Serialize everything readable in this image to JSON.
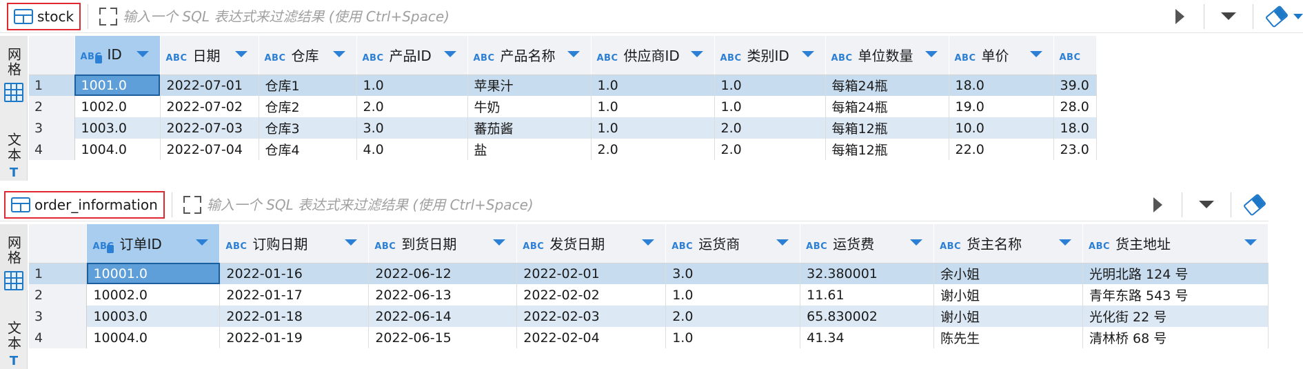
{
  "filter_placeholder": "输入一个 SQL 表达式来过滤结果 (使用 Ctrl+Space)",
  "side_tabs": {
    "grid": "网格",
    "text": "文本"
  },
  "stock": {
    "table_name": "stock",
    "columns": [
      {
        "type": "ABC",
        "name": "ID",
        "key": true
      },
      {
        "type": "ABC",
        "name": "日期"
      },
      {
        "type": "ABC",
        "name": "仓库"
      },
      {
        "type": "ABC",
        "name": "产品ID"
      },
      {
        "type": "ABC",
        "name": "产品名称"
      },
      {
        "type": "ABC",
        "name": "供应商ID"
      },
      {
        "type": "ABC",
        "name": "类别ID"
      },
      {
        "type": "ABC",
        "name": "单位数量"
      },
      {
        "type": "ABC",
        "name": "单价"
      },
      {
        "type": "ABC",
        "name": ""
      }
    ],
    "rows": [
      {
        "num": "1",
        "cells": [
          "1001.0",
          "2022-07-01",
          "仓库1",
          "1.0",
          "苹果汁",
          "1.0",
          "1.0",
          "每箱24瓶",
          "18.0",
          "39.0"
        ]
      },
      {
        "num": "2",
        "cells": [
          "1002.0",
          "2022-07-02",
          "仓库2",
          "2.0",
          "牛奶",
          "1.0",
          "1.0",
          "每箱24瓶",
          "19.0",
          "28.0"
        ]
      },
      {
        "num": "3",
        "cells": [
          "1003.0",
          "2022-07-03",
          "仓库3",
          "3.0",
          "蕃茄酱",
          "1.0",
          "2.0",
          "每箱12瓶",
          "10.0",
          "18.0"
        ]
      },
      {
        "num": "4",
        "cells": [
          "1004.0",
          "2022-07-04",
          "仓库4",
          "4.0",
          "盐",
          "2.0",
          "2.0",
          "每箱12瓶",
          "22.0",
          "23.0"
        ]
      }
    ]
  },
  "order_information": {
    "table_name": "order_information",
    "columns": [
      {
        "type": "ABC",
        "name": "订单ID",
        "key": true
      },
      {
        "type": "ABC",
        "name": "订购日期"
      },
      {
        "type": "ABC",
        "name": "到货日期"
      },
      {
        "type": "ABC",
        "name": "发货日期"
      },
      {
        "type": "ABC",
        "name": "运货商"
      },
      {
        "type": "ABC",
        "name": "运货费"
      },
      {
        "type": "ABC",
        "name": "货主名称"
      },
      {
        "type": "ABC",
        "name": "货主地址"
      }
    ],
    "rows": [
      {
        "num": "1",
        "cells": [
          "10001.0",
          "2022-01-16",
          "2022-06-12",
          "2022-02-01",
          "3.0",
          "32.380001",
          "余小姐",
          "光明北路 124 号"
        ]
      },
      {
        "num": "2",
        "cells": [
          "10002.0",
          "2022-01-17",
          "2022-06-13",
          "2022-02-02",
          "1.0",
          "11.61",
          "谢小姐",
          "青年东路 543 号"
        ]
      },
      {
        "num": "3",
        "cells": [
          "10003.0",
          "2022-01-18",
          "2022-06-14",
          "2022-02-03",
          "2.0",
          "65.830002",
          "谢小姐",
          "光化街 22 号"
        ]
      },
      {
        "num": "4",
        "cells": [
          "10004.0",
          "2022-01-19",
          "2022-06-15",
          "2022-02-04",
          "1.0",
          "41.34",
          "陈先生",
          "清林桥 68 号"
        ]
      }
    ]
  }
}
